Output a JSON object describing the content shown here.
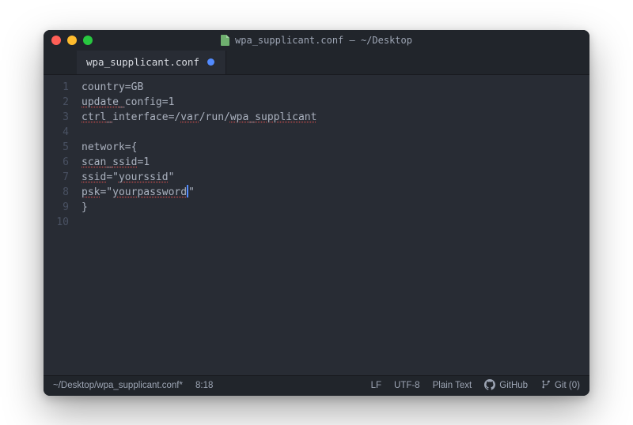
{
  "window": {
    "title": "wpa_supplicant.conf — ~/Desktop"
  },
  "tab": {
    "filename": "wpa_supplicant.conf",
    "modified": true
  },
  "code": {
    "lines": [
      {
        "n": 1,
        "segments": [
          {
            "t": "country=GB"
          }
        ]
      },
      {
        "n": 2,
        "segments": [
          {
            "t": "update_",
            "err": true
          },
          {
            "t": "config=1"
          }
        ]
      },
      {
        "n": 3,
        "segments": [
          {
            "t": "ctrl_",
            "err": true
          },
          {
            "t": "interface=/"
          },
          {
            "t": "var",
            "err": true
          },
          {
            "t": "/run/"
          },
          {
            "t": "wpa_supplicant",
            "err": true
          }
        ]
      },
      {
        "n": 4,
        "segments": [
          {
            "t": ""
          }
        ]
      },
      {
        "n": 5,
        "segments": [
          {
            "t": "network={"
          }
        ]
      },
      {
        "n": 6,
        "segments": [
          {
            "t": "scan_",
            "err": true
          },
          {
            "t": "ssid",
            "err": true
          },
          {
            "t": "=1"
          }
        ]
      },
      {
        "n": 7,
        "segments": [
          {
            "t": "ssid",
            "err": true
          },
          {
            "t": "=\""
          },
          {
            "t": "yourssid",
            "err": true
          },
          {
            "t": "\""
          }
        ]
      },
      {
        "n": 8,
        "segments": [
          {
            "t": "psk",
            "err": true
          },
          {
            "t": "=\""
          },
          {
            "t": "yourpassword",
            "err": true
          },
          {
            "cursor": true
          },
          {
            "t": "\""
          }
        ]
      },
      {
        "n": 9,
        "segments": [
          {
            "t": "}"
          }
        ]
      },
      {
        "n": 10,
        "segments": [
          {
            "t": ""
          }
        ]
      }
    ]
  },
  "status": {
    "filepath": "~/Desktop/wpa_supplicant.conf*",
    "cursor_pos": "8:18",
    "line_ending": "LF",
    "encoding": "UTF-8",
    "grammar": "Plain Text",
    "github_label": "GitHub",
    "git_label": "Git (0)"
  }
}
